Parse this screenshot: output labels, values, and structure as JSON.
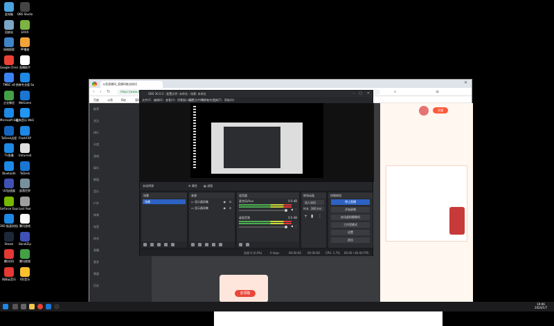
{
  "desktop_icons": [
    {
      "label": "此电脑",
      "color": "#4aa3df"
    },
    {
      "label": "OBS Studio",
      "color": "#444"
    },
    {
      "label": "回收站",
      "color": "#7aa7c7"
    },
    {
      "label": "EXXX",
      "color": "#7cb342"
    },
    {
      "label": "网络搜索",
      "color": "#3f83c8"
    },
    {
      "label": "PP播放",
      "color": "#f2a33a"
    },
    {
      "label": "Google Chrome",
      "color": "#e94235"
    },
    {
      "label": "直播助手",
      "color": "#ffffff"
    },
    {
      "label": "TMBC v8",
      "color": "#3b82f6"
    },
    {
      "label": "剪映专业版 Sam",
      "color": "#1e88e5"
    },
    {
      "label": "企业微信",
      "color": "#43a047"
    },
    {
      "label": "WeGame",
      "color": "#1976d2"
    },
    {
      "label": "Microsoft Edge",
      "color": "#1e88e5"
    },
    {
      "label": "酷狗音乐 WeGame",
      "color": "#2196f3"
    },
    {
      "label": "ToDesk远程",
      "color": "#1565c0"
    },
    {
      "label": "FlashFXP",
      "color": "#1e88e5"
    },
    {
      "label": "TV直播",
      "color": "#1e88e5"
    },
    {
      "label": "Unturned",
      "color": "#e0e0e0"
    },
    {
      "label": "Bluetooth",
      "color": "#1e88e5"
    },
    {
      "label": "ToDesk",
      "color": "#1976d2"
    },
    {
      "label": "UU加速器",
      "color": "#3f51b5"
    },
    {
      "label": "部落世界",
      "color": "#78909c"
    },
    {
      "label": "GeForce Experience",
      "color": "#76b900"
    },
    {
      "label": "Last Year",
      "color": "#9e9e9e"
    },
    {
      "label": "360 极速浏览器",
      "color": "#1e88e5"
    },
    {
      "label": "腾讯游戏",
      "color": "#fafafa"
    },
    {
      "label": "Steam",
      "color": "#1b2838"
    },
    {
      "label": "BandiZip",
      "color": "#3f51b5"
    },
    {
      "label": "腾讯QQ",
      "color": "#e53935"
    },
    {
      "label": "腾讯视频",
      "color": "#43a047"
    },
    {
      "label": "网易云音乐",
      "color": "#e53935"
    },
    {
      "label": "QQ音乐",
      "color": "#fbc02d"
    }
  ],
  "browser": {
    "tab_title": "斗鱼直播间_直播间推流测试",
    "url": "https://www.douyu.com/...",
    "bookmarks": [
      "百度",
      "斗鱼",
      "B站",
      "管理后台"
    ],
    "left_rows": [
      "推荐",
      "关注",
      "排行",
      "分类",
      "游戏",
      "娱乐",
      "颜值",
      "音乐",
      "户外",
      "体育",
      "电竞",
      "综合",
      "直播",
      "更多",
      "频道",
      "历史"
    ],
    "promo_button": "去领取",
    "right_button": "开播"
  },
  "obs": {
    "title": "OBS 30.0.2 - 配置文件: 未命名 - 场景: 未命名",
    "menu": [
      "文件(F)",
      "编辑(E)",
      "查看(V)",
      "停靠窗口(D)",
      "配置文件(P)",
      "场景集合(S)",
      "工具(T)",
      "帮助(H)"
    ],
    "source_bar_label": "未选择源",
    "properties_label": "属性",
    "filters_label": "滤镜",
    "docks": {
      "scenes_title": "场景",
      "scene_item": "场景",
      "sources_title": "来源",
      "source_items": [
        "显示器采集",
        "显示器采集"
      ],
      "mixer_title": "混音器",
      "mixer_rows": [
        {
          "name": "麦克风/Aux",
          "db": "0.0 dB"
        },
        {
          "name": "桌面音频",
          "db": "0.0 dB"
        }
      ],
      "transitions_title": "转场动画",
      "transition_value": "淡入淡出",
      "duration_label": "时长",
      "duration_value": "300 ms",
      "controls_title": "控制按钮",
      "controls": [
        "停止直播",
        "开始录制",
        "启动虚拟摄像机",
        "工作室模式",
        "设置",
        "退出"
      ]
    },
    "status": {
      "dropped": "丢帧 0 (0.0%)",
      "bitrate": "0 kbps",
      "live": "00:00:00",
      "rec": "00:00:00",
      "cpu": "CPU: 1.7%",
      "fps": "60.00 / 60.00 FPS"
    }
  },
  "taskbar": {
    "time": "19:06",
    "date": "2024/1/7"
  }
}
